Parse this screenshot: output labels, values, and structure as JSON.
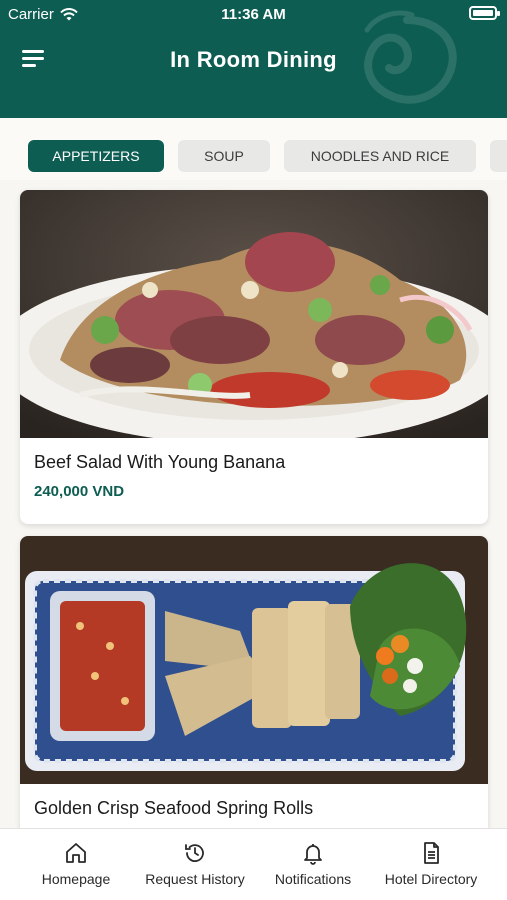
{
  "status_bar": {
    "carrier": "Carrier",
    "time": "11:36 AM",
    "battery_level": 1.0
  },
  "header": {
    "title": "In Room Dining",
    "menu_icon": "hamburger-icon",
    "color": "#0d5d52"
  },
  "tabs": [
    {
      "label": "APPETIZERS",
      "active": true
    },
    {
      "label": "SOUP",
      "active": false
    },
    {
      "label": "NOODLES AND RICE",
      "active": false
    },
    {
      "label": "",
      "active": false
    }
  ],
  "items": [
    {
      "name": "Beef Salad With Young Banana",
      "price": "240,000 VND",
      "image": "beef-salad-photo"
    },
    {
      "name": "Golden Crisp Seafood Spring Rolls",
      "price": "",
      "image": "spring-rolls-photo"
    }
  ],
  "bottom_nav": [
    {
      "label": "Homepage",
      "icon": "home-icon"
    },
    {
      "label": "Request History",
      "icon": "history-icon"
    },
    {
      "label": "Notifications",
      "icon": "bell-icon"
    },
    {
      "label": "Hotel Directory",
      "icon": "document-icon"
    }
  ],
  "colors": {
    "accent": "#0d5d52",
    "background": "#f7f6f2"
  }
}
